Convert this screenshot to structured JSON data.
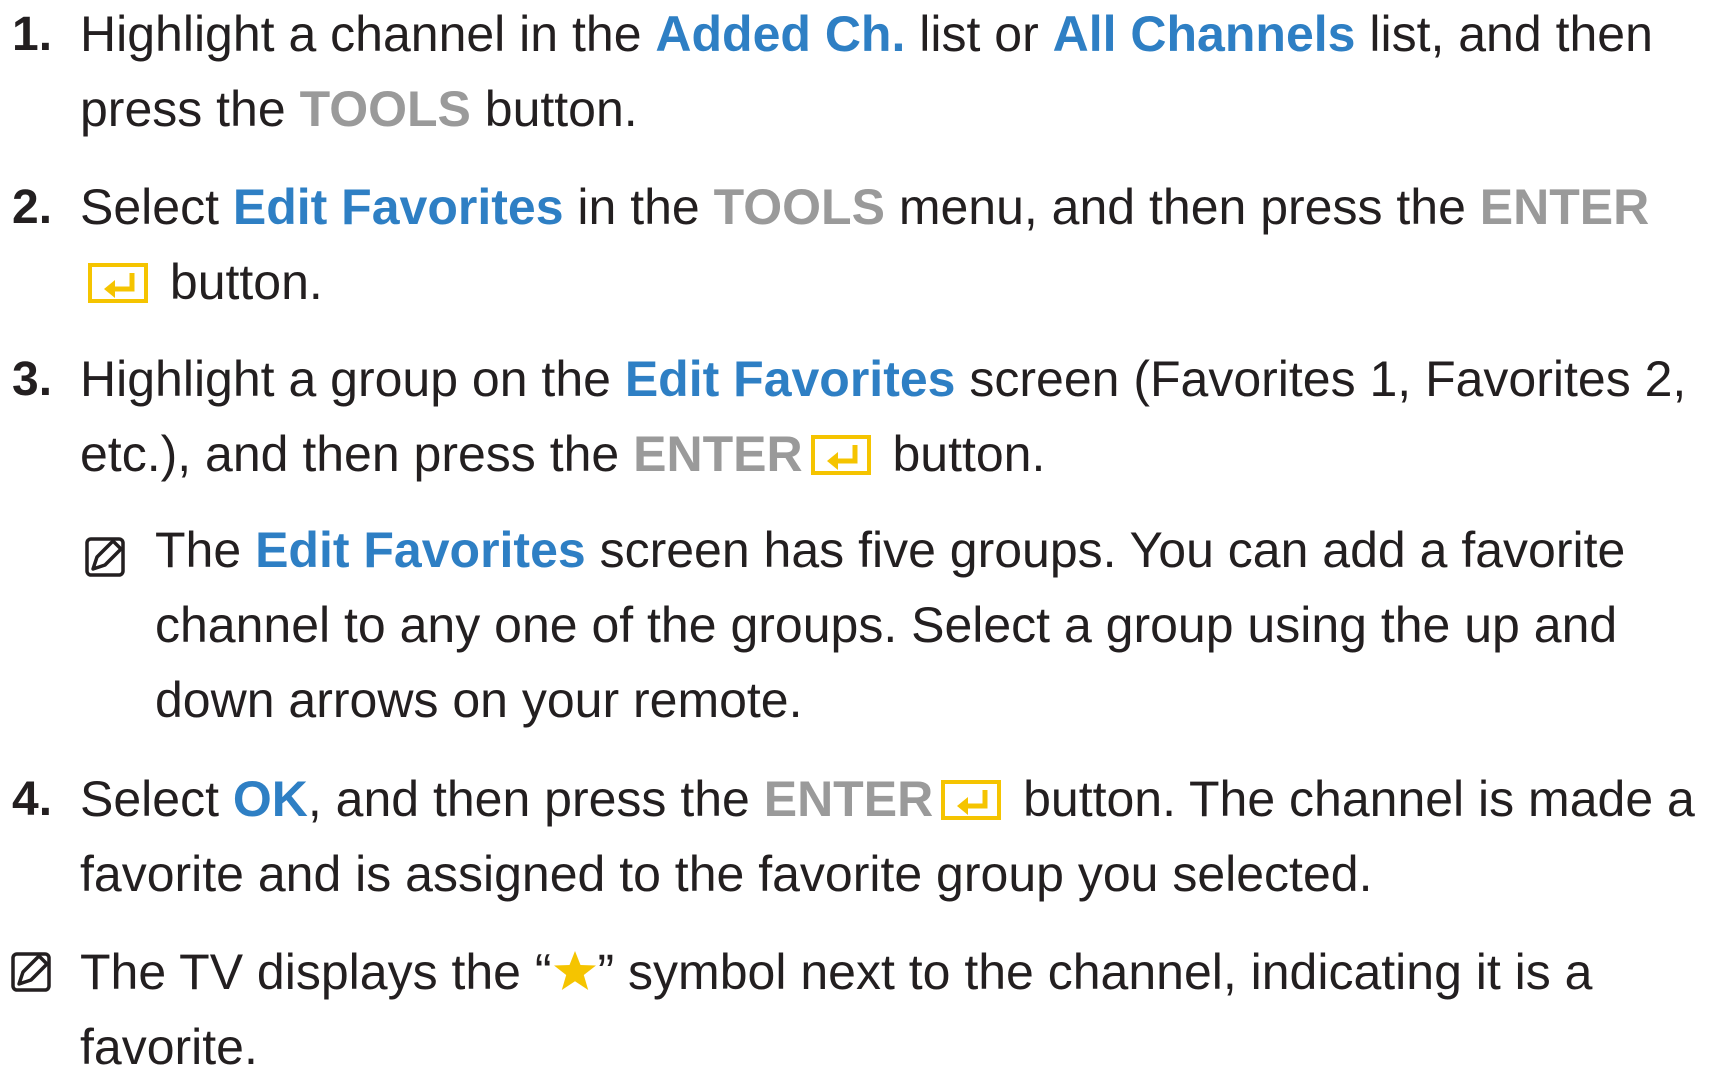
{
  "steps": [
    {
      "number": "1.",
      "parts": [
        "Highlight a channel in the ",
        "Added Ch.",
        " list or ",
        "All Channels",
        " list, and then press the ",
        "TOOLS",
        " button."
      ]
    },
    {
      "number": "2.",
      "parts": [
        "Select ",
        "Edit Favorites",
        " in the ",
        "TOOLS",
        " menu, and then press the ",
        "ENTER",
        " button."
      ]
    },
    {
      "number": "3.",
      "parts": [
        "Highlight a group on the ",
        "Edit Favorites",
        " screen (Favorites 1, Favorites 2, etc.), and then press the ",
        "ENTER",
        " button."
      ]
    },
    {
      "number": "4.",
      "parts": [
        "Select ",
        "OK",
        ", and then press the ",
        "ENTER",
        " button. The channel is made a favorite and is assigned to the favorite group you selected."
      ]
    }
  ],
  "inner_note": {
    "icon": "note-icon",
    "parts": [
      "The ",
      "Edit Favorites",
      " screen has five groups. You can add a favorite channel to any one of the groups. Select a group using the up and down arrows on your remote."
    ]
  },
  "outer_note": {
    "icon": "note-icon",
    "parts": [
      "The TV displays the “",
      "” symbol next to the channel, indicating it is a favorite."
    ]
  },
  "icons": {
    "enter": "enter-icon",
    "star": "star-icon"
  },
  "colors": {
    "highlight_blue": "#2e7fc4",
    "button_gray": "#9a9a9a",
    "icon_yellow": "#f5c400",
    "text": "#231f20"
  }
}
